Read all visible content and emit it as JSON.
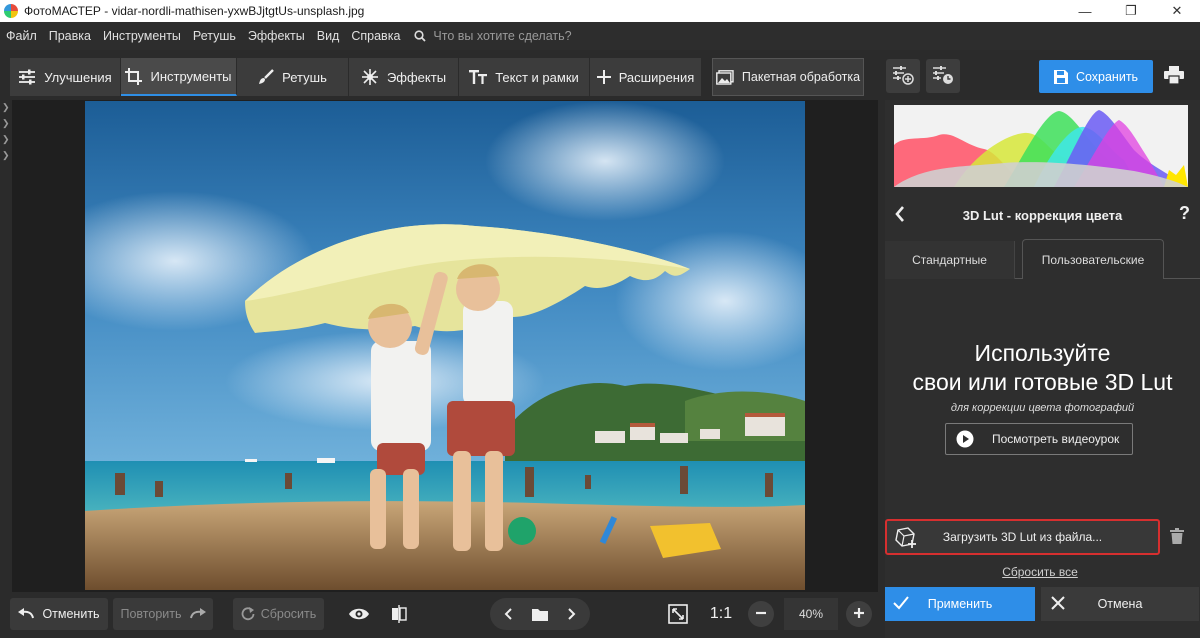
{
  "window": {
    "title": "ФотоМАСТЕР - vidar-nordli-mathisen-yxwBJjtgtUs-unsplash.jpg"
  },
  "menu": {
    "items": [
      "Файл",
      "Правка",
      "Инструменты",
      "Ретушь",
      "Эффекты",
      "Вид",
      "Справка"
    ],
    "search_placeholder": "Что вы хотите сделать?"
  },
  "toolbar": {
    "tabs": [
      {
        "label": "Улучшения",
        "icon": "sliders-icon"
      },
      {
        "label": "Инструменты",
        "icon": "crop-icon",
        "active": true
      },
      {
        "label": "Ретушь",
        "icon": "brush-icon"
      },
      {
        "label": "Эффекты",
        "icon": "sparkle-icon"
      },
      {
        "label": "Текст и рамки",
        "icon": "text-icon"
      },
      {
        "label": "Расширения",
        "icon": "plus-icon"
      }
    ],
    "batch_label": "Пакетная обработка",
    "save_label": "Сохранить"
  },
  "bottom": {
    "undo_label": "Отменить",
    "redo_label": "Повторить",
    "reset_label": "Сбросить",
    "zoom_one": "1:1",
    "zoom_value": "40%"
  },
  "panel": {
    "title": "3D Lut - коррекция цвета",
    "help": "?",
    "tab_standard": "Стандартные",
    "tab_custom": "Пользовательские",
    "promo_line1": "Используйте",
    "promo_line2": "свои или готовые 3D Lut",
    "promo_sub": "для коррекции цвета фотографий",
    "video_label": "Посмотреть видеоурок",
    "load_label": "Загрузить 3D Lut из файла...",
    "reset_all": "Сбросить все",
    "apply_label": "Применить",
    "cancel_label": "Отмена"
  },
  "colors": {
    "accent": "#2e8ee8",
    "highlight_border": "#d62f2f",
    "panel_bg": "#2e2e2e",
    "canvas_bg": "#1f1f1f"
  }
}
